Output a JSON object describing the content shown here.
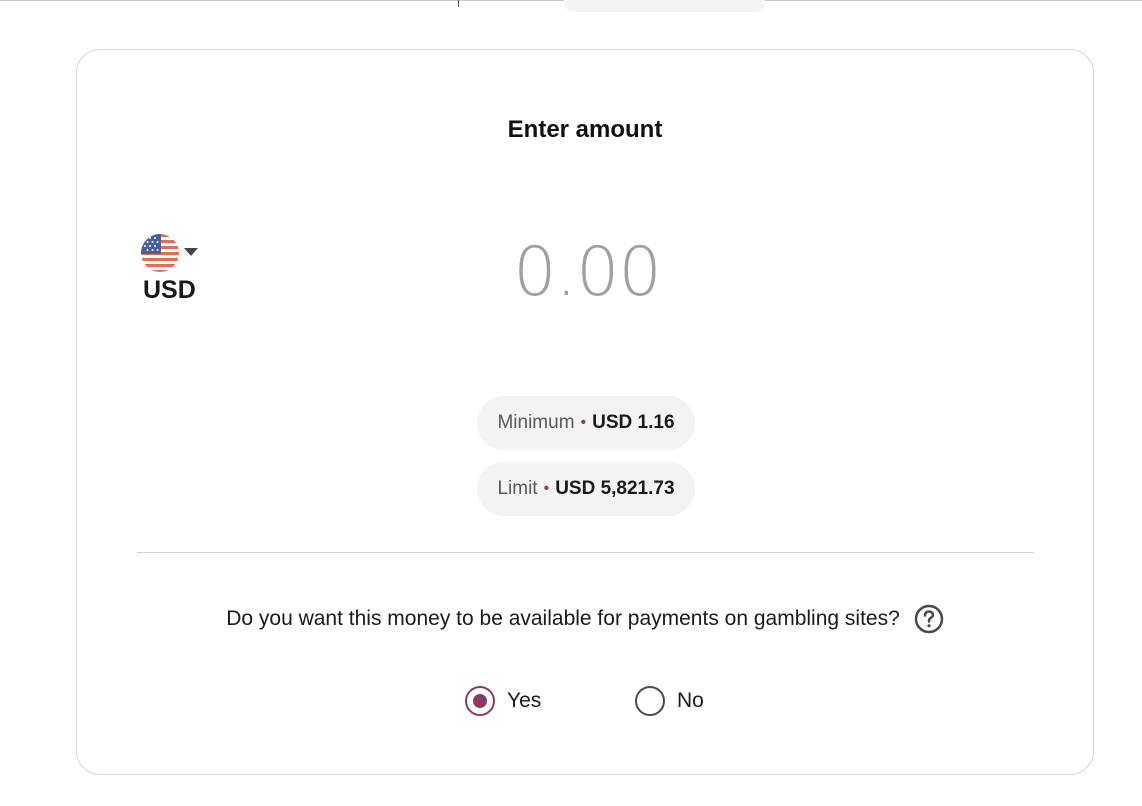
{
  "title": "Enter amount",
  "currency": {
    "code": "USD",
    "flag_icon": "us-flag-icon",
    "dropdown_icon": "caret-down-icon"
  },
  "amount": {
    "placeholder": "0.00",
    "value": ""
  },
  "limits": {
    "minimum_label": "Minimum",
    "minimum_value": "USD 1.16",
    "limit_label": "Limit",
    "limit_value": "USD 5,821.73",
    "separator": "•"
  },
  "gambling": {
    "question": "Do you want this money to be available for payments on gambling sites?",
    "help_icon": "question-circle-icon",
    "options": [
      {
        "label": "Yes",
        "selected": true
      },
      {
        "label": "No",
        "selected": false
      }
    ]
  },
  "colors": {
    "accent": "#8a3a66",
    "pill_background": "#f3f3f3",
    "placeholder_text": "#a0a0a0"
  }
}
